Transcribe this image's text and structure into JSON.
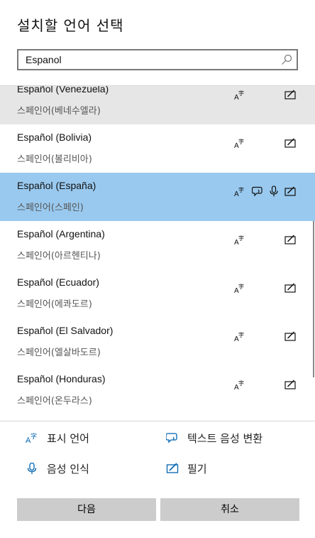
{
  "dialog": {
    "title": "설치할 언어 선택"
  },
  "search": {
    "value": "Espanol"
  },
  "colors": {
    "accent": "#0063b1",
    "selected_row": "#99c9ef",
    "hover_row": "#e6e6e6",
    "button_bg": "#cccccc"
  },
  "languages": [
    {
      "name": "Español (Venezuela)",
      "native": "스페인어(베네수엘라)",
      "state": "hover",
      "features": [
        "display-language-icon",
        "handwriting-icon"
      ]
    },
    {
      "name": "Español (Bolivia)",
      "native": "스페인어(볼리비아)",
      "state": "normal",
      "features": [
        "display-language-icon",
        "handwriting-icon"
      ]
    },
    {
      "name": "Español (España)",
      "native": "스페인어(스페인)",
      "state": "selected",
      "features": [
        "display-language-icon",
        "text-to-speech-icon",
        "speech-recognition-icon",
        "handwriting-icon"
      ]
    },
    {
      "name": "Español (Argentina)",
      "native": "스페인어(아르헨티나)",
      "state": "normal",
      "features": [
        "display-language-icon",
        "handwriting-icon"
      ]
    },
    {
      "name": "Español (Ecuador)",
      "native": "스페인어(에콰도르)",
      "state": "normal",
      "features": [
        "display-language-icon",
        "handwriting-icon"
      ]
    },
    {
      "name": "Español (El Salvador)",
      "native": "스페인어(엘살바도르)",
      "state": "normal",
      "features": [
        "display-language-icon",
        "handwriting-icon"
      ]
    },
    {
      "name": "Español (Honduras)",
      "native": "스페인어(온두라스)",
      "state": "normal",
      "features": [
        "display-language-icon",
        "handwriting-icon"
      ]
    }
  ],
  "legend": {
    "display_language": "표시 언어",
    "text_to_speech": "텍스트 음성 변환",
    "speech_recognition": "음성 인식",
    "handwriting": "필기"
  },
  "buttons": {
    "next": "다음",
    "cancel": "취소"
  }
}
